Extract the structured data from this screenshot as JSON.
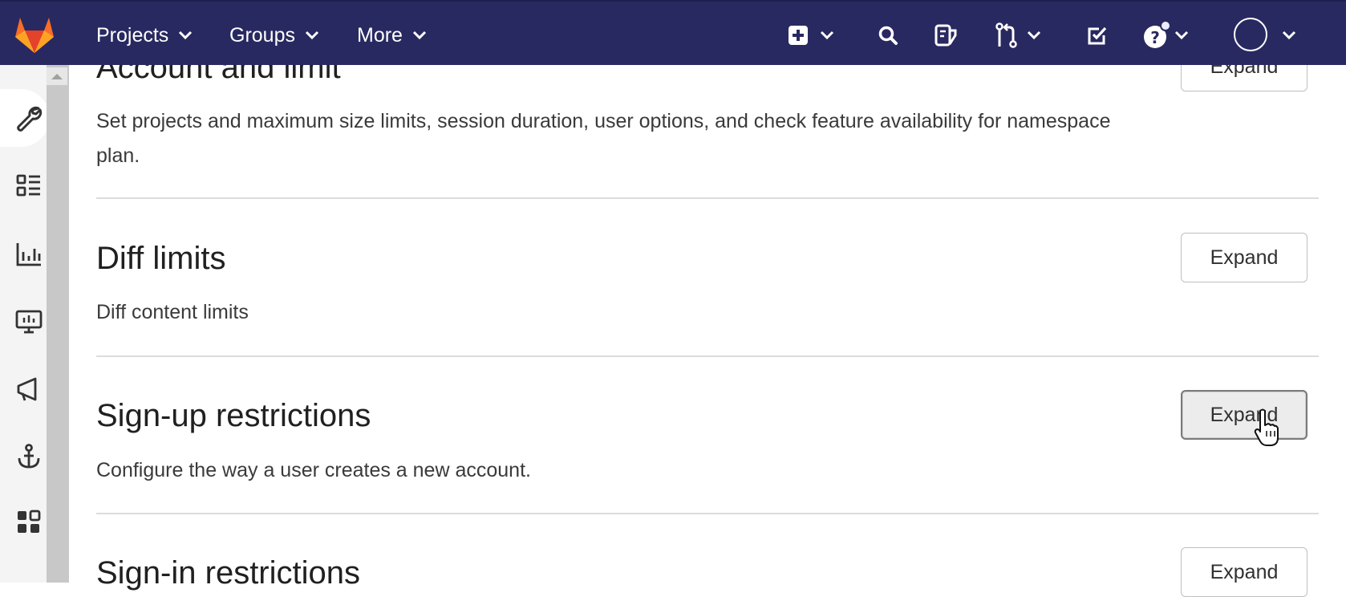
{
  "navbar": {
    "logo": "gitlab-tanuki-logo",
    "menu": [
      {
        "label": "Projects"
      },
      {
        "label": "Groups"
      },
      {
        "label": "More"
      }
    ],
    "icons": [
      "plus-square-icon",
      "search-icon",
      "issues-icon",
      "merge-request-icon",
      "todo-icon",
      "help-icon",
      "avatar"
    ],
    "colors": {
      "background": "#292961",
      "foreground": "#ffffff",
      "logo": "#e24329"
    }
  },
  "sidebar": {
    "icons": [
      "wrench-icon",
      "overview-icon",
      "analytics-icon",
      "monitoring-icon",
      "messages-icon",
      "hooks-icon",
      "applications-icon"
    ],
    "active": "wrench-icon"
  },
  "sections": [
    {
      "title": "Account and limit",
      "description": "Set projects and maximum size limits, session duration, user options, and check feature availability for namespace plan.",
      "button": "Expand"
    },
    {
      "title": "Diff limits",
      "description": "Diff content limits",
      "button": "Expand"
    },
    {
      "title": "Sign-up restrictions",
      "description": "Configure the way a user creates a new account.",
      "button": "Expand",
      "hovered": true
    },
    {
      "title": "Sign-in restrictions",
      "description": "",
      "button": "Expand"
    }
  ]
}
